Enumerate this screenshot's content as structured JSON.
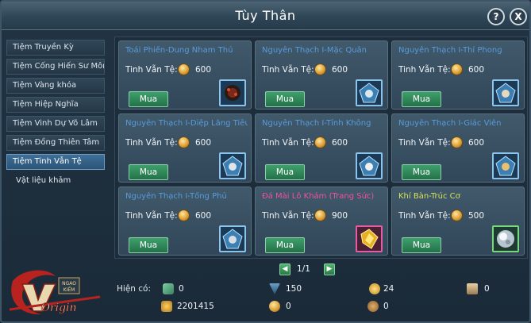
{
  "window": {
    "title": "Tùy Thân"
  },
  "sidebar": {
    "items": [
      {
        "label": "Tiệm Truyền Kỳ"
      },
      {
        "label": "Tiệm Cống Hiến Sư Môn"
      },
      {
        "label": "Tiệm Vàng khóa"
      },
      {
        "label": "Tiệm Hiệp Nghĩa"
      },
      {
        "label": "Tiệm Vinh Dự Võ Lâm"
      },
      {
        "label": "Tiệm Đồng Thiên Tâm"
      },
      {
        "label": "Tiệm Tinh Vẫn Tệ",
        "active": true
      }
    ],
    "sub_item": "Vật liệu khảm"
  },
  "products": [
    {
      "name": "Toái Phiến-Dung Nham Thú",
      "price_label": "Tinh Vẫn Tệ:",
      "price": "600",
      "buy": "Mua"
    },
    {
      "name": "Nguyên Thạch I-Mặc Quân",
      "price_label": "Tinh Vẫn Tệ:",
      "price": "600",
      "buy": "Mua"
    },
    {
      "name": "Nguyên Thạch I-Thí Phong",
      "price_label": "Tinh Vẫn Tệ:",
      "price": "600",
      "buy": "Mua"
    },
    {
      "name": "Nguyên Thạch I-Diệp Lăng Tiêu",
      "price_label": "Tinh Vẫn Tệ:",
      "price": "600",
      "buy": "Mua"
    },
    {
      "name": "Nguyên Thạch I-Tỉnh Không",
      "price_label": "Tinh Vẫn Tệ:",
      "price": "600",
      "buy": "Mua"
    },
    {
      "name": "Nguyên Thạch I-Giác Viễn",
      "price_label": "Tinh Vẫn Tệ:",
      "price": "600",
      "buy": "Mua"
    },
    {
      "name": "Nguyên Thạch I-Tổng Phủ",
      "price_label": "Tinh Vẫn Tệ:",
      "price": "600",
      "buy": "Mua"
    },
    {
      "name": "Đá Mài Lỗ Khảm (Trang Sức)",
      "price_label": "Tinh Vẫn Tệ:",
      "price": "900",
      "buy": "Mua"
    },
    {
      "name": "Khí Bàn-Trúc Cơ",
      "price_label": "Tinh Vẫn Tệ:",
      "price": "500",
      "buy": "Mua"
    }
  ],
  "pagination": {
    "text": "1/1"
  },
  "footer": {
    "label": "Hiện có:",
    "values": [
      "0",
      "150",
      "24",
      "0",
      "2201415",
      "0",
      "0"
    ]
  }
}
